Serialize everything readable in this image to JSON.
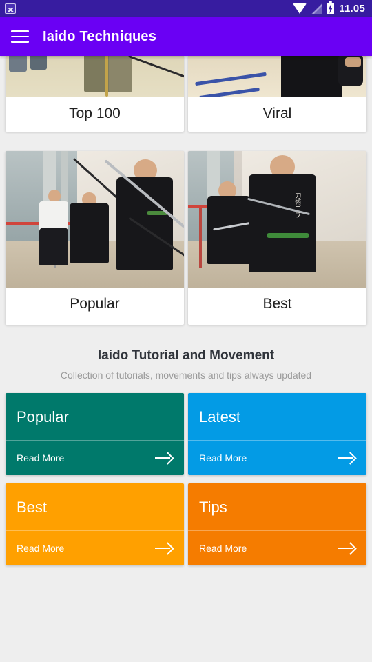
{
  "status_bar": {
    "notification_icon": "photo-icon",
    "wifi_icon": "wifi-icon",
    "signal_icon": "signal-off-icon",
    "battery_icon": "battery-charging-icon",
    "time": "11.05",
    "background_color": "#371ca0"
  },
  "app_bar": {
    "menu_icon": "hamburger-menu-icon",
    "title": "Iaido Techniques",
    "background_color": "#6a00f4"
  },
  "photo_cards": {
    "row_1": [
      {
        "label": "Top 100"
      },
      {
        "label": "Viral"
      }
    ],
    "row_2": [
      {
        "label": "Popular"
      },
      {
        "label": "Best"
      }
    ]
  },
  "section": {
    "title": "Iaido Tutorial and Movement",
    "subtitle": "Collection of tutorials, movements and tips always updated"
  },
  "tiles": [
    {
      "title": "Popular",
      "read_more": "Read More",
      "color": "#00796b",
      "arrow": "arrow-right-icon"
    },
    {
      "title": "Latest",
      "read_more": "Read More",
      "color": "#039be5",
      "arrow": "arrow-right-icon"
    },
    {
      "title": "Best",
      "read_more": "Read More",
      "color": "#ffa000",
      "arrow": "arrow-right-icon"
    },
    {
      "title": "Tips",
      "read_more": "Read More",
      "color": "#f57c00",
      "arrow": "arrow-right-icon"
    }
  ],
  "theme": {
    "background": "#eeeeee",
    "card_background": "#ffffff",
    "text_primary": "#212121",
    "text_muted": "#9a9a9a"
  }
}
